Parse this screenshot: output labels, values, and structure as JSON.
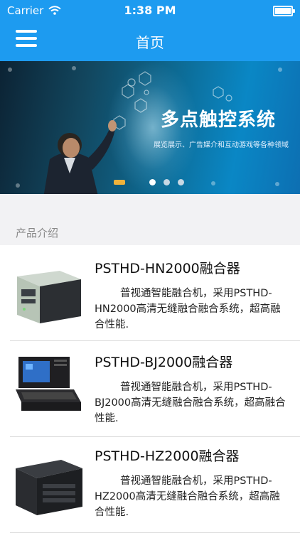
{
  "status_bar": {
    "carrier": "Carrier",
    "time": "1:38 PM"
  },
  "nav": {
    "title": "首页",
    "menu_icon": "menu-icon"
  },
  "banner": {
    "title": "多点触控系统",
    "subtitle": "展览展示、广告媒介和互动游戏等各种领域",
    "slide_count": 4,
    "active_slide": 1
  },
  "section": {
    "title": "产品介绍"
  },
  "products": [
    {
      "title": "PSTHD-HN2000融合器",
      "description": "普视通智能融合机，采用PSTHD-HN2000高清无缝融合融合系统，超高融合性能."
    },
    {
      "title": "PSTHD-BJ2000融合器",
      "description": "普视通智能融合机，采用PSTHD-BJ2000高清无缝融合融合系统，超高融合性能."
    },
    {
      "title": "PSTHD-HZ2000融合器",
      "description": "普视通智能融合机，采用PSTHD-HZ2000高清无缝融合融合系统，超高融合性能."
    }
  ],
  "colors": {
    "accent": "#1d9bf0",
    "background": "#f2f2f4"
  }
}
